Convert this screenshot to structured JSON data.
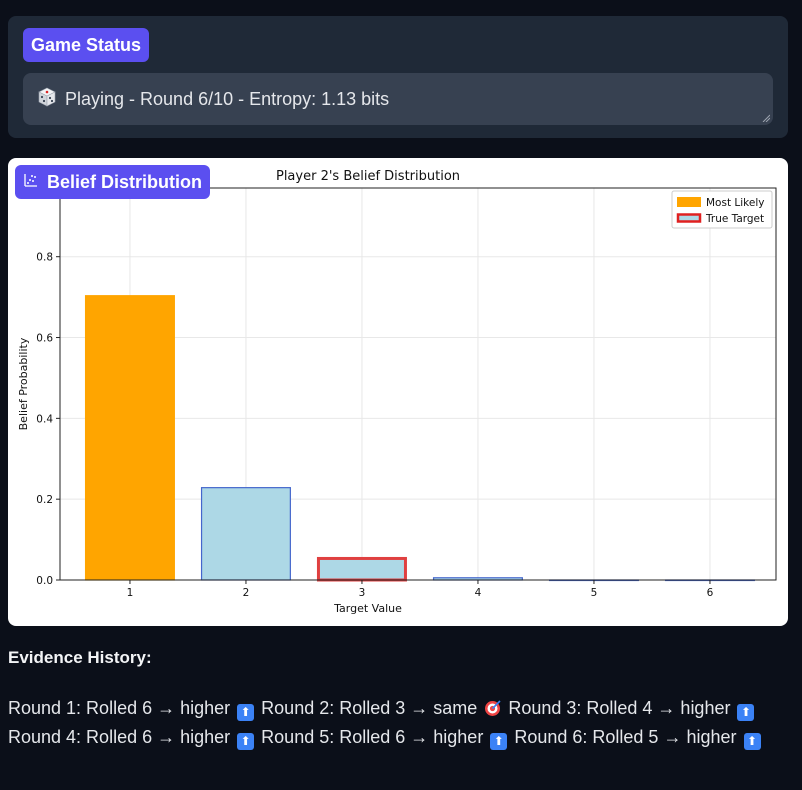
{
  "status": {
    "badge_label": "Game Status",
    "text": "Playing - Round 6/10 - Entropy: 1.13 bits",
    "icon": "dice-icon"
  },
  "belief": {
    "badge_label": "Belief Distribution",
    "icon": "chart-icon"
  },
  "chart_data": {
    "type": "bar",
    "title": "Player 2's Belief Distribution",
    "xlabel": "Target Value",
    "ylabel": "Belief Probability",
    "categories": [
      "1",
      "2",
      "3",
      "4",
      "5",
      "6"
    ],
    "values": [
      0.705,
      0.23,
      0.057,
      0.007,
      0.0005,
      0.0002
    ],
    "ylim": [
      0,
      0.97
    ],
    "yticks": [
      "0.0",
      "0.2",
      "0.4",
      "0.6",
      "0.8"
    ],
    "grid": true,
    "legend_position": "top-right",
    "legend": [
      {
        "label": "Most Likely",
        "color": "#ffa500"
      },
      {
        "label": "True Target",
        "color": "#add8e6",
        "edge": "#e02020"
      }
    ],
    "most_likely_index": 0,
    "true_target_index": 2,
    "colors": {
      "default": "#add8e6",
      "default_edge": "#4466cc",
      "most_likely": "#ffa500",
      "target_edge": "#e04040"
    }
  },
  "evidence": {
    "title": "Evidence History:",
    "rounds": [
      {
        "text": "Round 1: Rolled 6 → higher",
        "icon": "up-arrow"
      },
      {
        "text": "Round 2: Rolled 3 → same",
        "icon": "target"
      },
      {
        "text": "Round 3: Rolled 4 → higher",
        "icon": "up-arrow"
      },
      {
        "text": "Round 4: Rolled 6 → higher",
        "icon": "up-arrow"
      },
      {
        "text": "Round 5: Rolled 6 → higher",
        "icon": "up-arrow"
      },
      {
        "text": "Round 6: Rolled 5 → higher",
        "icon": "up-arrow"
      }
    ]
  }
}
